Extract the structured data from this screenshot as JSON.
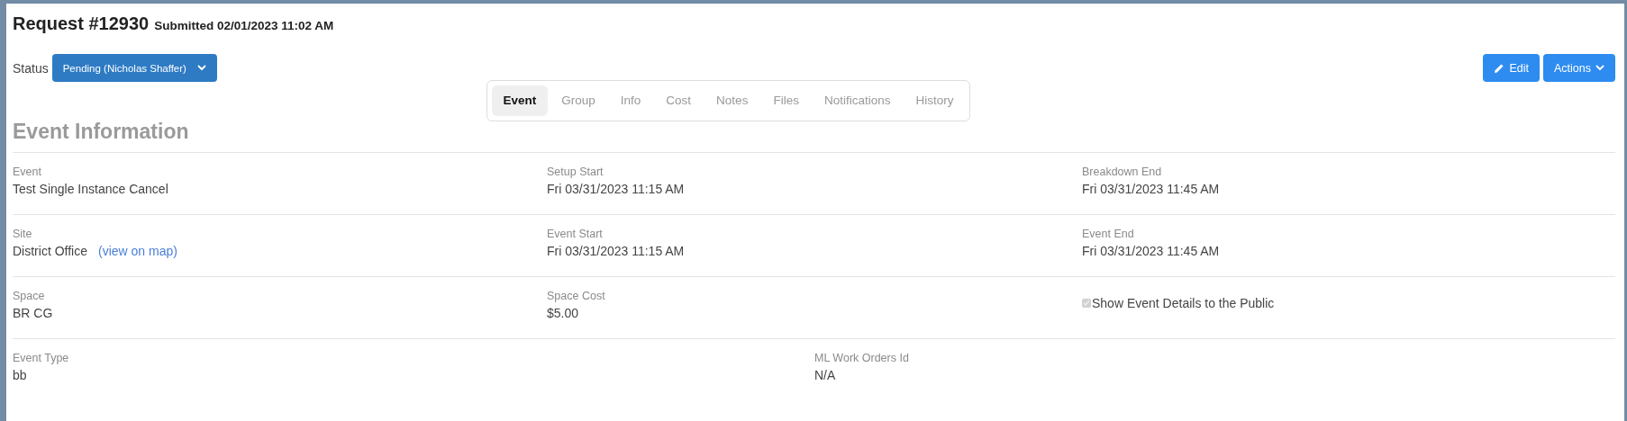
{
  "header": {
    "title": "Request #12930",
    "submitted": "Submitted 02/01/2023 11:02 AM"
  },
  "status": {
    "label": "Status",
    "value": "Pending (Nicholas Shaffer)"
  },
  "actions": [
    {
      "kind": "edit",
      "label": "Edit"
    },
    {
      "kind": "dropdown",
      "label": "Actions"
    }
  ],
  "tabs": [
    {
      "label": "Event",
      "selected": true
    },
    {
      "label": "Group",
      "selected": false
    },
    {
      "label": "Info",
      "selected": false
    },
    {
      "label": "Cost",
      "selected": false
    },
    {
      "label": "Notes",
      "selected": false
    },
    {
      "label": "Files",
      "selected": false
    },
    {
      "label": "Notifications",
      "selected": false
    },
    {
      "label": "History",
      "selected": false
    }
  ],
  "section_title": "Event Information",
  "rows": [
    {
      "fields": [
        {
          "kind": "text",
          "label": "Event",
          "value": "Test Single Instance Cancel"
        },
        {
          "kind": "text",
          "label": "Setup Start",
          "value": "Fri 03/31/2023 11:15 AM"
        },
        {
          "kind": "text",
          "label": "Breakdown End",
          "value": "Fri 03/31/2023 11:45 AM"
        }
      ]
    },
    {
      "fields": [
        {
          "kind": "link",
          "label": "Site",
          "value": "District Office",
          "link": "(view on map)"
        },
        {
          "kind": "text",
          "label": "Event Start",
          "value": "Fri 03/31/2023 11:15 AM"
        },
        {
          "kind": "text",
          "label": "Event End",
          "value": "Fri 03/31/2023 11:45 AM"
        }
      ]
    },
    {
      "fields": [
        {
          "kind": "text",
          "label": "Space",
          "value": "BR CG"
        },
        {
          "kind": "text",
          "label": "Space Cost",
          "value": "$5.00"
        },
        {
          "kind": "checkbox",
          "label": "Show Event Details to the Public",
          "checked": true,
          "disabled": true
        }
      ]
    },
    {
      "fields": [
        {
          "kind": "text",
          "label": "Event Type",
          "value": "bb"
        },
        {
          "kind": "text",
          "label": "ML Work Orders Id",
          "value": "N/A"
        }
      ]
    }
  ]
}
